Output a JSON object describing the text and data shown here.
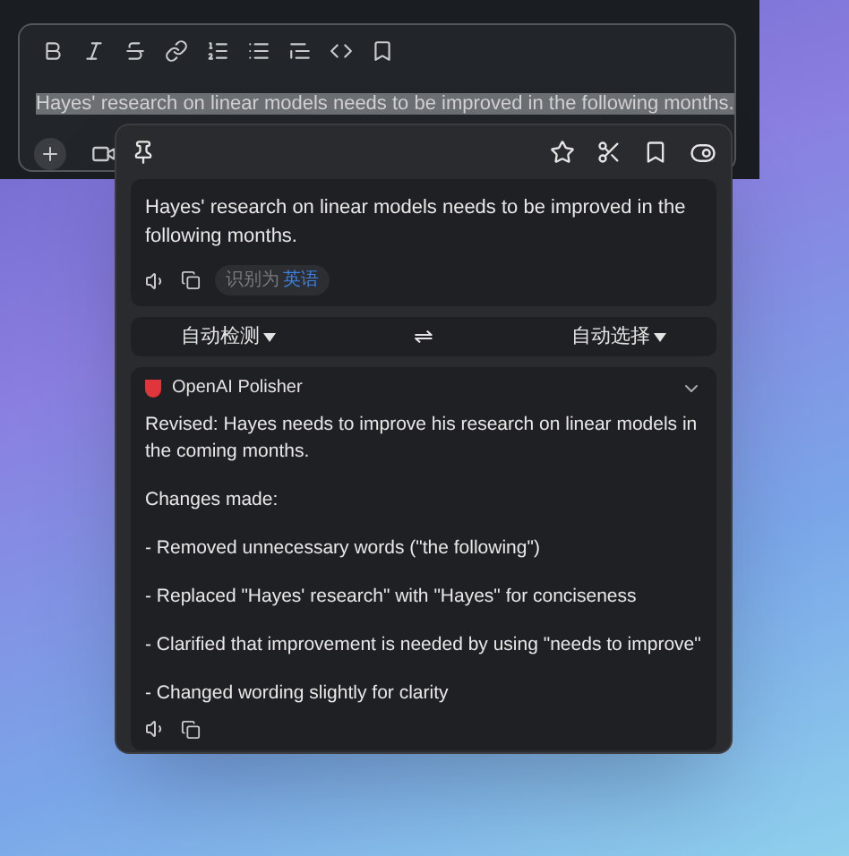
{
  "editor": {
    "text": "Hayes' research on linear models needs to be improved in the following months.",
    "selected": true
  },
  "popup": {
    "pinned": false,
    "source": {
      "text": "Hayes' research on linear models needs to be improved in the following months.",
      "detected_label": "识别为",
      "detected_language": "英语"
    },
    "languages": {
      "from": "自动检测",
      "to": "自动选择",
      "swap": "⇌"
    },
    "result": {
      "service": "OpenAI Polisher",
      "expanded": true,
      "paragraphs": [
        "Revised: Hayes needs to improve his research on linear models in the coming months.",
        "Changes made:",
        "- Removed unnecessary words (\"the following\")",
        "- Replaced \"Hayes' research\" with \"Hayes\" for conciseness",
        "- Clarified that improvement is needed by using \"needs to improve\"",
        "- Changed wording slightly for clarity"
      ]
    }
  }
}
